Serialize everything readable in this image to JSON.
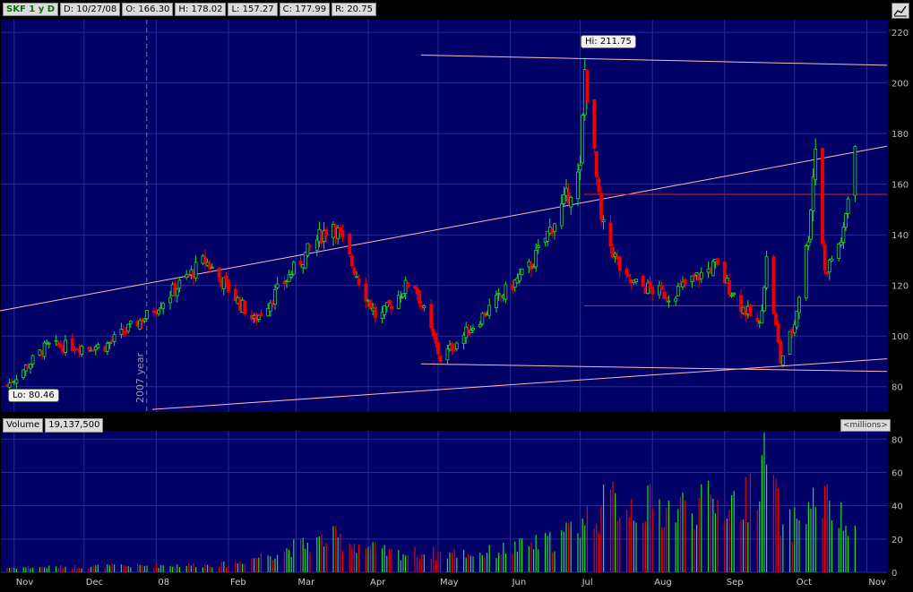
{
  "header": {
    "ticker": "SKF 1 y D",
    "date": "D: 10/27/08",
    "open": "O: 166.30",
    "high": "H: 178.02",
    "low": "L: 157.27",
    "close": "C: 177.99",
    "range": "R: 20.75"
  },
  "volume_header": {
    "label": "Volume",
    "value": "19,137,500",
    "units": "<millions>"
  },
  "annotations": {
    "hi": "Hi: 211.75",
    "lo": "Lo: 80.46",
    "year": "2007 year"
  },
  "colors": {
    "background": "#000066",
    "up": "#22dd22",
    "down": "#ee0000",
    "grid": "#2a2a99",
    "trendline": "#ffbbbb",
    "hline": "#dd2222"
  },
  "chart_data": [
    {
      "type": "candlestick",
      "ylim": [
        70,
        225
      ],
      "y_ticks": [
        "220",
        "200",
        "180",
        "160",
        "140",
        "120",
        "100",
        "80"
      ],
      "x_ticks": [
        "Nov",
        "Dec",
        "08",
        "Feb",
        "Mar",
        "Apr",
        "May",
        "Jun",
        "Jul",
        "Aug",
        "Sep",
        "Oct",
        "Nov"
      ],
      "grid": true,
      "horizontal_levels": [
        156,
        112
      ],
      "anchors": [
        {
          "date": "Oct 29",
          "close": 80.5
        },
        {
          "date": "Nov 15",
          "close": 96
        },
        {
          "date": "Dec 10",
          "close": 96
        },
        {
          "date": "Dec 28",
          "close": 108
        },
        {
          "date": "Jan 22",
          "close": 130
        },
        {
          "date": "Feb 12",
          "close": 106
        },
        {
          "date": "Mar 10",
          "close": 138
        },
        {
          "date": "Mar 17",
          "close": 145
        },
        {
          "date": "Apr 5",
          "close": 106
        },
        {
          "date": "Apr 20",
          "close": 123
        },
        {
          "date": "May 2",
          "close": 91
        },
        {
          "date": "May 20",
          "close": 108
        },
        {
          "date": "Jun 10",
          "close": 128
        },
        {
          "date": "Jul 1",
          "close": 165
        },
        {
          "date": "Jul 3",
          "close": 205
        },
        {
          "date": "Jul 10",
          "close": 145
        },
        {
          "date": "Jul 20",
          "close": 122
        },
        {
          "date": "Aug 8",
          "close": 116
        },
        {
          "date": "Aug 28",
          "close": 128
        },
        {
          "date": "Sep 8",
          "close": 112
        },
        {
          "date": "Sep 16",
          "close": 104
        },
        {
          "date": "Sep 19",
          "close": 130
        },
        {
          "date": "Sep 25",
          "close": 90
        },
        {
          "date": "Oct 1",
          "close": 105
        },
        {
          "date": "Oct 7",
          "close": 140
        },
        {
          "date": "Oct 10",
          "close": 175
        },
        {
          "date": "Oct 14",
          "close": 125
        },
        {
          "date": "Oct 22",
          "close": 140
        },
        {
          "date": "Oct 27",
          "close": 178
        }
      ]
    },
    {
      "type": "bar",
      "name": "Volume",
      "ylim": [
        0,
        85
      ],
      "y_ticks": [
        "80",
        "60",
        "40",
        "20",
        "0"
      ],
      "anchors": [
        {
          "date": "Oct 29",
          "value": 3
        },
        {
          "date": "Feb 1",
          "value": 5
        },
        {
          "date": "Mar 17",
          "value": 22
        },
        {
          "date": "Apr 10",
          "value": 12
        },
        {
          "date": "May 20",
          "value": 12
        },
        {
          "date": "Jun 20",
          "value": 20
        },
        {
          "date": "Jul 15",
          "value": 45
        },
        {
          "date": "Aug 5",
          "value": 40
        },
        {
          "date": "Sep 10",
          "value": 45
        },
        {
          "date": "Sep 19",
          "value": 77
        },
        {
          "date": "Sep 26",
          "value": 25
        },
        {
          "date": "Oct 12",
          "value": 48
        },
        {
          "date": "Oct 27",
          "value": 22
        }
      ]
    }
  ]
}
